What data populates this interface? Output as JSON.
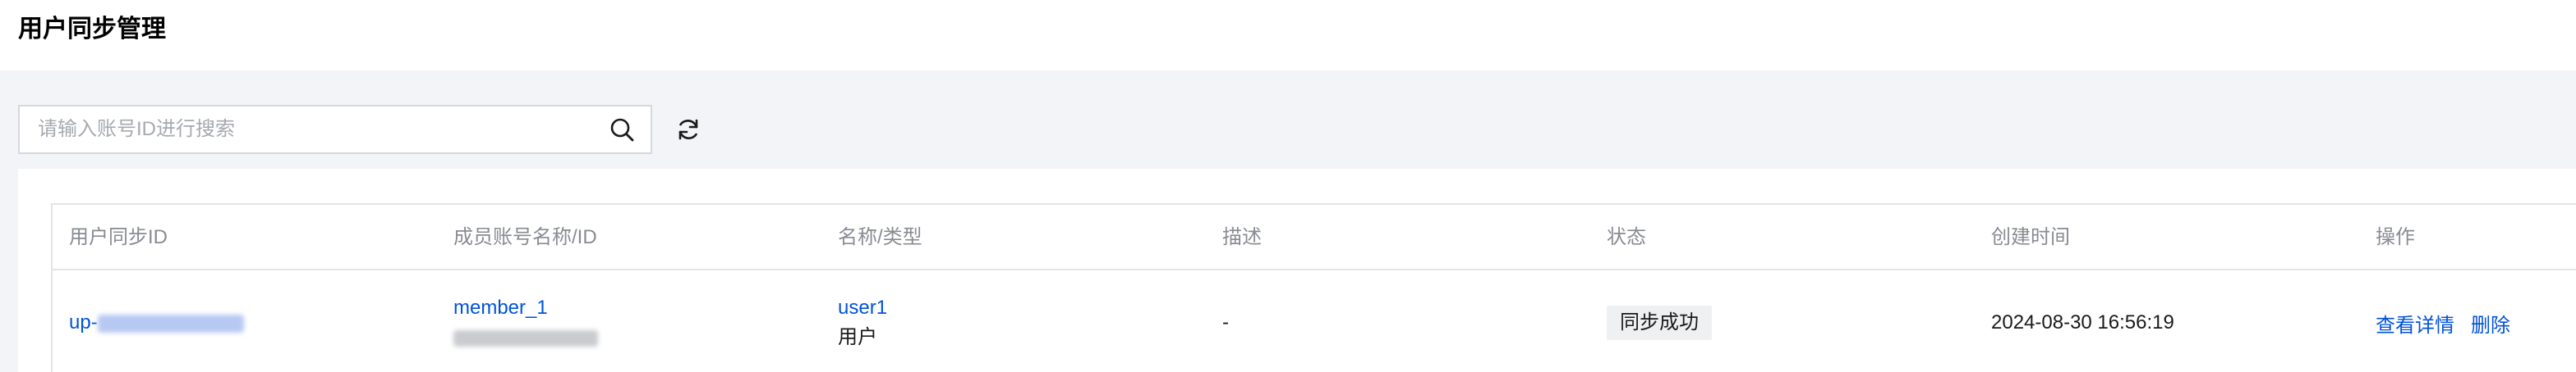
{
  "page": {
    "title": "用户同步管理"
  },
  "search": {
    "placeholder": "请输入账号ID进行搜索",
    "value": ""
  },
  "table": {
    "columns": [
      "用户同步ID",
      "成员账号名称/ID",
      "名称/类型",
      "描述",
      "状态",
      "创建时间",
      "操作"
    ],
    "rows": [
      {
        "sync_id_prefix": "up-",
        "member_name": "member_1",
        "name": "user1",
        "type": "用户",
        "description": "-",
        "status": "同步成功",
        "created_at": "2024-08-30 16:56:19",
        "actions": {
          "view": "查看详情",
          "delete": "删除"
        }
      }
    ]
  },
  "colors": {
    "link": "#0052d9",
    "page_bg": "#f3f4f7",
    "border": "#e2e4e8",
    "header_text": "#888b92"
  },
  "icons": {
    "search": "search-icon",
    "refresh": "refresh-icon"
  }
}
